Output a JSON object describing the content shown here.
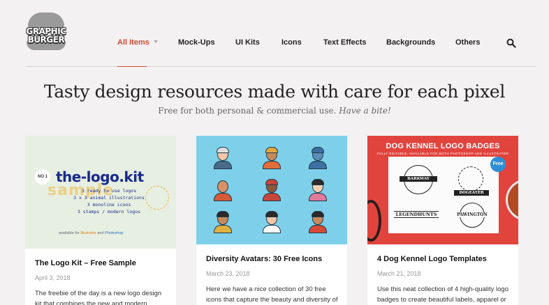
{
  "brand": {
    "logo_line1": "GRAPHIC",
    "logo_line2": "BURGER"
  },
  "nav": {
    "items": [
      {
        "label": "All Items",
        "active": true
      },
      {
        "label": "Mock-Ups"
      },
      {
        "label": "UI Kits"
      },
      {
        "label": "Icons"
      },
      {
        "label": "Text Effects"
      },
      {
        "label": "Backgrounds"
      },
      {
        "label": "Others"
      }
    ],
    "search_icon": "search-icon",
    "accent_color": "#d24a35"
  },
  "hero": {
    "title": "Tasty design resources made with care for each pixel",
    "subtitle": "Free for both personal & commercial use.",
    "subtitle_emphasis": "Have a bite!"
  },
  "cards": [
    {
      "title": "The Logo Kit – Free Sample",
      "date": "April 3, 2018",
      "description": "The freebie of the day is a new logo design kit that combines the new and modern",
      "thumb": {
        "badge": "NO 1",
        "heading": "the-logo.kit",
        "overlay": "sample",
        "lines": [
          "3 ready to use logos",
          "3 x 3 animal illustrations",
          "3 monoline icons",
          "3 stamps / modern logos"
        ],
        "footer_prefix": "available for",
        "footer_ai": "Illustrator",
        "footer_and": "and",
        "footer_ps": "Photoshop"
      }
    },
    {
      "title": "Diversity Avatars: 30 Free Icons",
      "date": "March 23, 2018",
      "description": "Here we have a nice collection of 30 free icons that capture the beauty and diversity of"
    },
    {
      "title": "4 Dog Kennel Logo Templates",
      "date": "March 21, 2018",
      "description": "Use this neat collection of 4 high-quality logo badges to create beautiful labels, apparel or",
      "thumb": {
        "heading": "DOG KENNEL LOGO BADGES",
        "subheading": "FULLY EDITABLE, AVAILABLE FOR BOTH PHOTOSHOP AND ILLUSTRATOR",
        "free": "Free",
        "badges": [
          "BARKWAY",
          "DOGEATER",
          "LEGENDHUNTS",
          "PAWINGTON"
        ]
      }
    }
  ]
}
